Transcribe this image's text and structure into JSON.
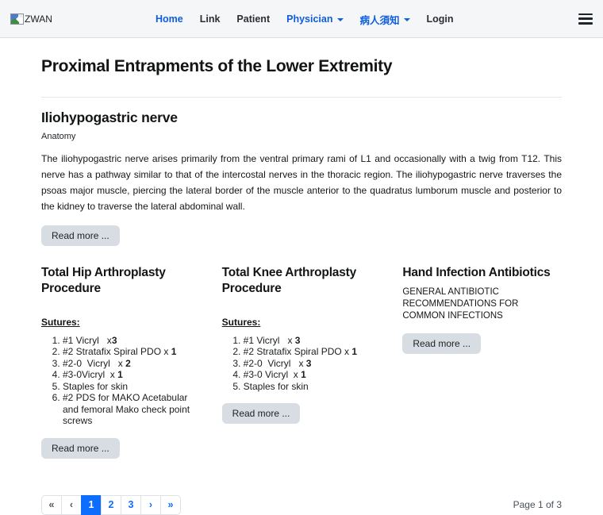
{
  "navbar": {
    "logo_alt": "ZWAN",
    "items": [
      {
        "label": "Home",
        "active": true,
        "dropdown": false
      },
      {
        "label": "Link",
        "active": false,
        "dropdown": false
      },
      {
        "label": "Patient",
        "active": false,
        "dropdown": false
      },
      {
        "label": "Physician",
        "active": true,
        "dropdown": true
      },
      {
        "label": "病人須知",
        "active": true,
        "dropdown": true
      },
      {
        "label": "Login",
        "active": false,
        "dropdown": false
      }
    ]
  },
  "icons": {
    "logo": "broken-image",
    "menu": "hamburger",
    "dropdown_caret": "caret-down"
  },
  "page": {
    "title": "Proximal Entrapments of the Lower Extremity"
  },
  "article": {
    "title": "Iliohypogastric nerve",
    "subtitle": "Anatomy",
    "body": "The iliohypogastric nerve arises primarily from the ventral primary rami of L1 and occasionally with a twig from T12. This nerve has a pathway similar to that of the intercostal nerves in the thoracic region. The iliohypogastric nerve traverses the psoas major muscle, piercing the lateral border of the muscle anterior to the quadratus lumborum muscle and posterior to the kidney to traverse the lateral abdominal wall.",
    "read_more": "Read more ..."
  },
  "columns": [
    {
      "title": "Total Hip Arthroplasty Procedure",
      "sutures_label": "Sutures:",
      "items": [
        {
          "text": "#1 Vicryl   x",
          "bold": "3"
        },
        {
          "text": "#2 Stratafix Spiral PDO x ",
          "bold": "1"
        },
        {
          "text": "#2-0  Vicryl   x ",
          "bold": "2"
        },
        {
          "text": "#3-0Vicryl  x ",
          "bold": "1"
        },
        {
          "text": "Staples for skin",
          "bold": ""
        },
        {
          "text": "#2 PDS for MAKO Acetabular and femoral Mako check point screws",
          "bold": ""
        }
      ],
      "read_more": "Read more ..."
    },
    {
      "title": "Total Knee Arthroplasty Procedure",
      "sutures_label": "Sutures:",
      "items": [
        {
          "text": "#1 Vicryl   x ",
          "bold": "3"
        },
        {
          "text": "#2 Stratafix Spiral PDO x ",
          "bold": "1"
        },
        {
          "text": "#2-0  Vicryl   x ",
          "bold": "3"
        },
        {
          "text": "#3-0 Vicryl  x ",
          "bold": "1"
        },
        {
          "text": "Staples for skin",
          "bold": ""
        }
      ],
      "read_more": "Read more ..."
    },
    {
      "title": "Hand Infection Antibiotics",
      "intro": "GENERAL ANTIBIOTIC RECOMMENDATIONS FOR COMMON INFECTIONS",
      "read_more": "Read more ..."
    }
  ],
  "pagination": {
    "items": [
      {
        "label": "«",
        "state": "disabled"
      },
      {
        "label": "‹",
        "state": "disabled"
      },
      {
        "label": "1",
        "state": "active"
      },
      {
        "label": "2",
        "state": "link"
      },
      {
        "label": "3",
        "state": "link"
      },
      {
        "label": "›",
        "state": "link"
      },
      {
        "label": "»",
        "state": "link"
      }
    ],
    "counter": "Page 1 of 3"
  },
  "colors": {
    "accent_blue": "#0d6efd",
    "navbar_bg": "#f5f6f8",
    "button_bg": "#d7dde3"
  }
}
